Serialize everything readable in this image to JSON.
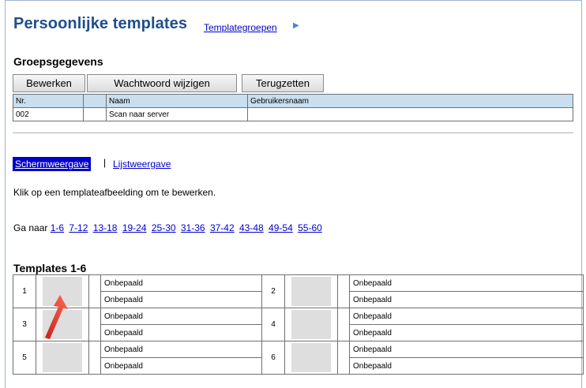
{
  "title": "Persoonlijke templates",
  "template_groups_link": "Templategroepen",
  "section_title": "Groepsgegevens",
  "buttons": {
    "edit": "Bewerken",
    "change_password": "Wachtwoord wijzigen",
    "reset": "Terugzetten"
  },
  "group_table": {
    "headers": [
      "Nr.",
      "",
      "Naam",
      "Gebruikersnaam"
    ],
    "row": [
      "002",
      "",
      "Scan naar server",
      ""
    ]
  },
  "view_tabs": {
    "screen": "Schermweergave",
    "separator": "|",
    "list": "Lijstweergave"
  },
  "instruction": "Klik op een templateafbeelding om te bewerken.",
  "goto": {
    "label": "Ga naar",
    "links": [
      "1-6",
      "7-12",
      "13-18",
      "19-24",
      "25-30",
      "31-36",
      "37-42",
      "43-48",
      "49-54",
      "55-60"
    ]
  },
  "templates_heading": "Templates 1-6",
  "templates": [
    {
      "num": "1",
      "line1": "Onbepaald",
      "line2": "Onbepaald"
    },
    {
      "num": "2",
      "line1": "Onbepaald",
      "line2": "Onbepaald"
    },
    {
      "num": "3",
      "line1": "Onbepaald",
      "line2": "Onbepaald"
    },
    {
      "num": "4",
      "line1": "Onbepaald",
      "line2": "Onbepaald"
    },
    {
      "num": "5",
      "line1": "Onbepaald",
      "line2": "Onbepaald"
    },
    {
      "num": "6",
      "line1": "Onbepaald",
      "line2": "Onbepaald"
    }
  ],
  "colors": {
    "title": "#1f4e8c",
    "header_bg": "#c9dff0",
    "link": "#0000cc",
    "selected_tab": "#0000cc",
    "annotation_arrow": "#e53b2c"
  }
}
